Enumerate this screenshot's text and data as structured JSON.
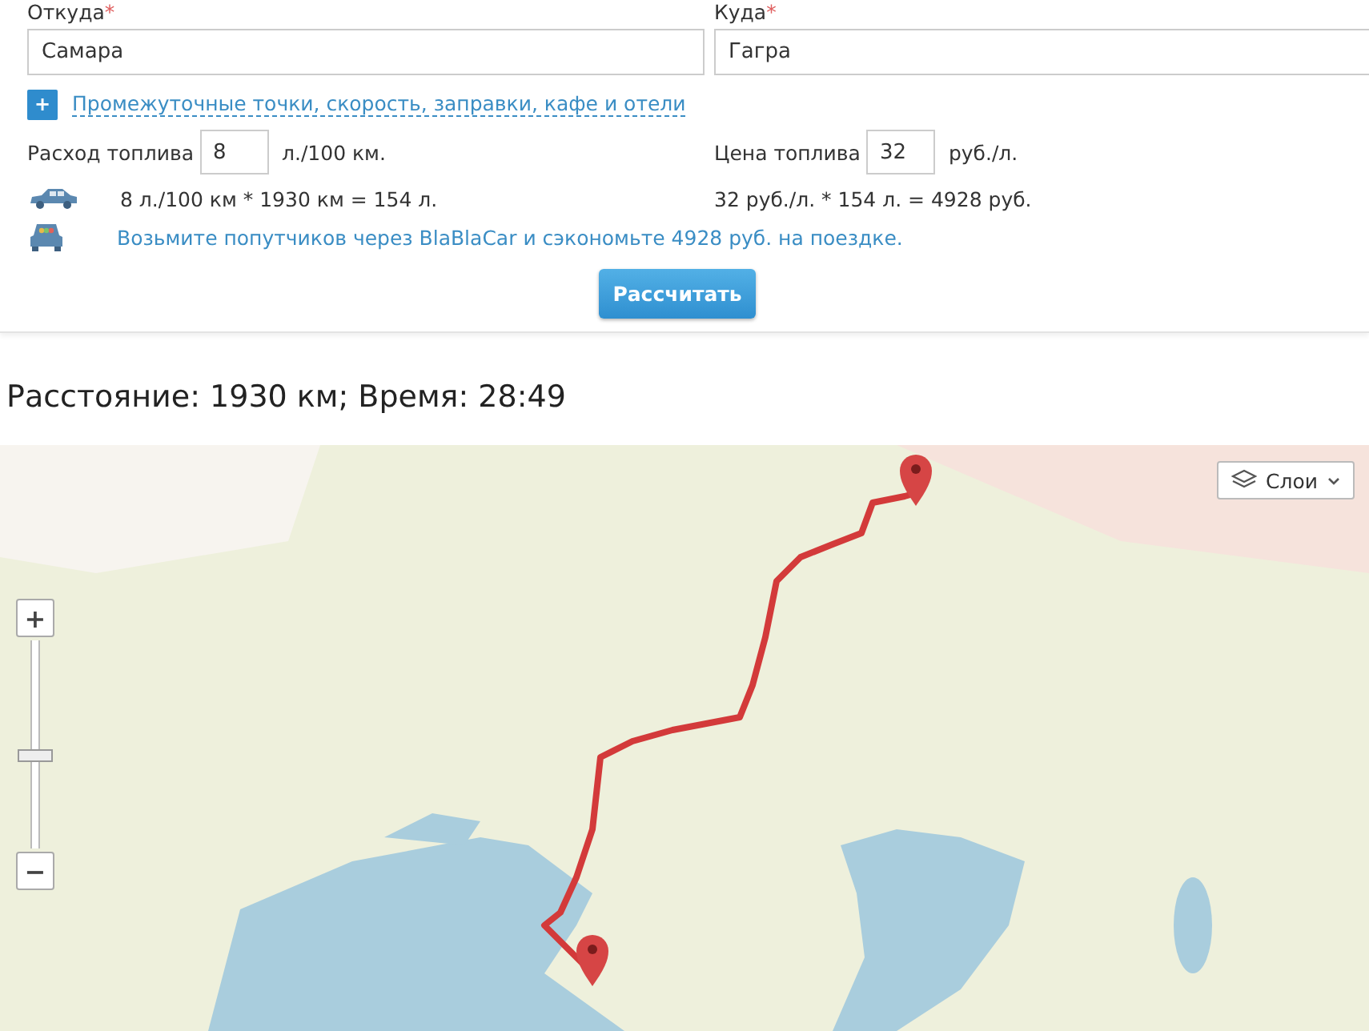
{
  "form": {
    "fields": [
      {
        "label": "Откуда",
        "required_mark": "*",
        "value": "Самара"
      },
      {
        "label": "Куда",
        "required_mark": "*",
        "value": "Гагра"
      }
    ],
    "extras_button": "+",
    "extras_link": "Промежуточные точки, скорость, заправки, кафе и отели",
    "consumption": {
      "label": "Расход топлива",
      "value": "8",
      "unit": "л./100 км."
    },
    "price": {
      "label": "Цена топлива",
      "value": "32",
      "unit": "руб./л."
    },
    "fuel_formula": "8 л./100 км * 1930 км = 154 л.",
    "cost_formula": "32 руб./л. * 154 л. = 4928 руб.",
    "blablacar_link": "Возьмите попутчиков через BlaBlaCar и сэкономьте 4928 руб. на поездке.",
    "calculate_button": "Рассчитать"
  },
  "result": "Расстояние: 1930 км; Время: 28:49",
  "map": {
    "zoom_in": "+",
    "zoom_out": "−",
    "zoom": {
      "level": 0.45
    },
    "layers_button": "Слои"
  }
}
